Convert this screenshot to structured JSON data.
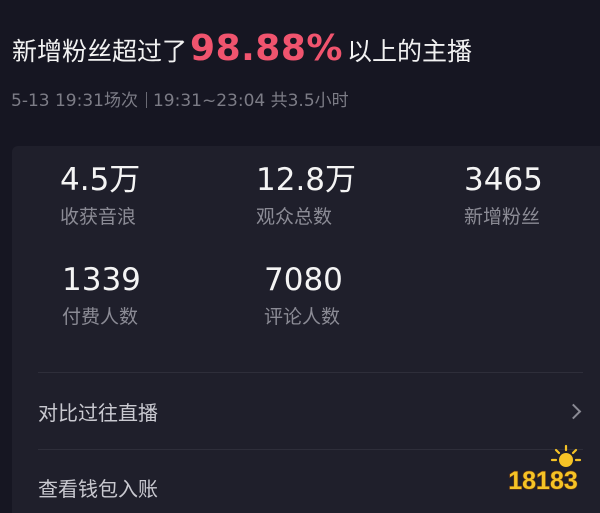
{
  "headline": {
    "prefix": "新增粉丝超过了",
    "percent": "98.88%",
    "suffix": "以上的主播"
  },
  "session": {
    "date_time": "5-13 19:31场次",
    "time_range": "19:31~23:04 共3.5小时"
  },
  "stats": [
    {
      "value": "4.5万",
      "label": "收获音浪"
    },
    {
      "value": "12.8万",
      "label": "观众总数"
    },
    {
      "value": "3465",
      "label": "新增粉丝"
    },
    {
      "value": "1339",
      "label": "付费人数"
    },
    {
      "value": "7080",
      "label": "评论人数"
    }
  ],
  "actions": {
    "compare_label": "对比过往直播",
    "wallet_label": "查看钱包入账"
  },
  "watermark": {
    "text": "18183"
  },
  "colors": {
    "background": "#161622",
    "card": "#1f1f2b",
    "accent_pink": "#f0546e",
    "watermark_yellow": "#f5c326"
  }
}
